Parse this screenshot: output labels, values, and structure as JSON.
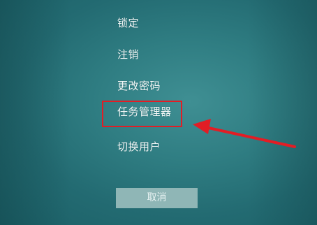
{
  "menu": {
    "items": [
      {
        "label": "锁定"
      },
      {
        "label": "注销"
      },
      {
        "label": "更改密码"
      },
      {
        "label": "任务管理器"
      },
      {
        "label": "切换用户"
      }
    ]
  },
  "cancel": {
    "label": "取消"
  },
  "annotation": {
    "highlight_color": "#e21d25",
    "arrow_color": "#e21d25"
  },
  "theme": {
    "background": "#2f7d82",
    "text_color": "#f2f7f7",
    "button_bg": "#8fb6b6"
  }
}
